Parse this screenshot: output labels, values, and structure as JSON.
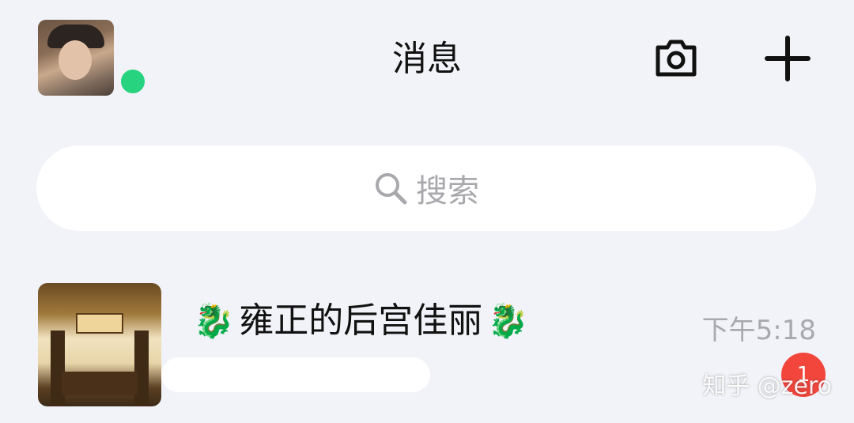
{
  "header": {
    "title": "消息",
    "status_color": "#27d37f",
    "icons": [
      "camera-icon",
      "plus-icon"
    ]
  },
  "search": {
    "placeholder": "搜索",
    "icon": "search-icon"
  },
  "chats": [
    {
      "name": "雍正的后宫佳丽",
      "name_prefix_emoji": "🐉",
      "name_suffix_emoji": "🐉",
      "time": "下午5:18",
      "unread": "1"
    }
  ],
  "watermark": "知乎 @zero",
  "colors": {
    "background": "#f2f3f8",
    "badge": "#f2463d",
    "muted_text": "#a8a8ad"
  }
}
